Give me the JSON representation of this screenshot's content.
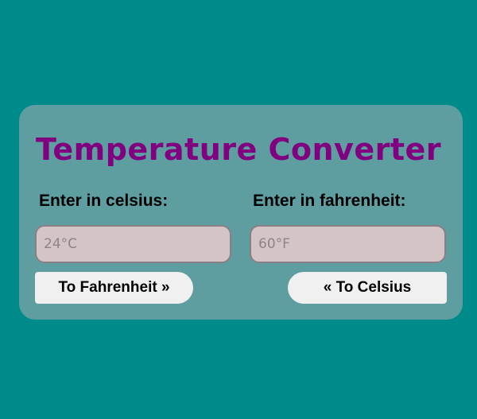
{
  "title": "Temperature Converter",
  "celsius": {
    "label": "Enter in celsius:",
    "placeholder": "24°C",
    "value": ""
  },
  "fahrenheit": {
    "label": "Enter in fahrenheit:",
    "placeholder": "60°F",
    "value": ""
  },
  "buttons": {
    "to_fahrenheit": "To Fahrenheit »",
    "to_celsius": "« To Celsius"
  },
  "colors": {
    "page_background": "#008b8b",
    "card_background": "#5f9ea0",
    "title": "#800080",
    "input_background": "#d5c4c5",
    "button_background": "#f0f0f0"
  }
}
